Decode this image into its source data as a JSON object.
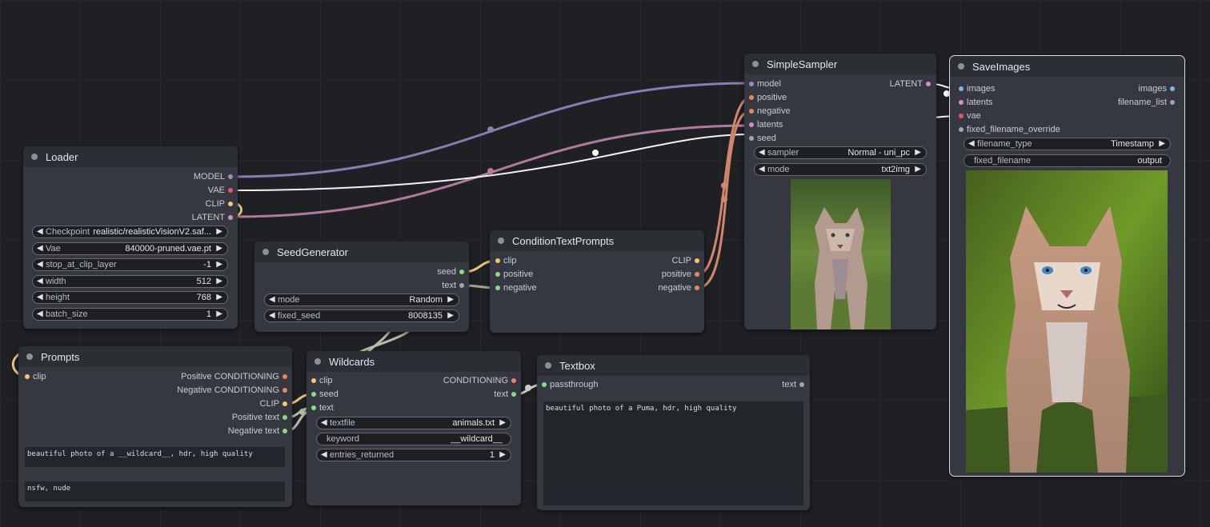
{
  "colors": {
    "model": "#9b8bc4",
    "clip": "#f0c870",
    "vae": "#e05a62",
    "latent": "#d88fbd",
    "conditioning": "#e08a5e",
    "seed": "#84e07a",
    "text": "#a2a6ac",
    "image": "#7eb6e0"
  },
  "loader": {
    "title": "Loader",
    "outputs": [
      "MODEL",
      "VAE",
      "CLIP",
      "LATENT"
    ],
    "widgets": [
      {
        "label": "Checkpoint",
        "value": "realistic/realisticVisionV2.saf..."
      },
      {
        "label": "Vae",
        "value": "840000-pruned.vae.pt"
      },
      {
        "label": "stop_at_clip_layer",
        "value": "-1"
      },
      {
        "label": "width",
        "value": "512"
      },
      {
        "label": "height",
        "value": "768"
      },
      {
        "label": "batch_size",
        "value": "1"
      }
    ]
  },
  "seedgen": {
    "title": "SeedGenerator",
    "outputs": [
      "seed",
      "text"
    ],
    "widgets": [
      {
        "label": "mode",
        "value": "Random"
      },
      {
        "label": "fixed_seed",
        "value": "8008135"
      }
    ]
  },
  "cond": {
    "title": "ConditionTextPrompts",
    "inputs": [
      "clip",
      "positive",
      "negative"
    ],
    "outputs": [
      "CLIP",
      "positive",
      "negative"
    ]
  },
  "sampler": {
    "title": "SimpleSampler",
    "inputs": [
      "model",
      "positive",
      "negative",
      "latents",
      "seed"
    ],
    "outputs": [
      "LATENT"
    ],
    "widgets": [
      {
        "label": "sampler",
        "value": "Normal - uni_pc"
      },
      {
        "label": "mode",
        "value": "txt2img"
      }
    ]
  },
  "save": {
    "title": "SaveImages",
    "inputs": [
      "images",
      "latents",
      "vae",
      "fixed_filename_override"
    ],
    "outputs": [
      "images",
      "filename_list"
    ],
    "widgets": [
      {
        "label": "filename_type",
        "value": "Timestamp"
      },
      {
        "label": "fixed_filename",
        "value": "output"
      }
    ]
  },
  "prompts": {
    "title": "Prompts",
    "inputs": [
      "clip"
    ],
    "outputs": [
      "Positive CONDITIONING",
      "Negative CONDITIONING",
      "CLIP",
      "Positive text",
      "Negative text"
    ],
    "positive_text": "beautiful photo of a __wildcard__, hdr, high quality",
    "negative_text": "nsfw, nude"
  },
  "wildcards": {
    "title": "Wildcards",
    "inputs": [
      "clip",
      "seed",
      "text"
    ],
    "outputs": [
      "CONDITIONING",
      "text"
    ],
    "widgets": [
      {
        "label": "textfile",
        "value": "animals.txt"
      },
      {
        "label": "keyword",
        "value": "__wildcard__"
      },
      {
        "label": "entries_returned",
        "value": "1"
      }
    ]
  },
  "textbox": {
    "title": "Textbox",
    "inputs": [
      "passthrough"
    ],
    "outputs": [
      "text"
    ],
    "content": "beautiful photo of a Puma, hdr, high quality"
  }
}
